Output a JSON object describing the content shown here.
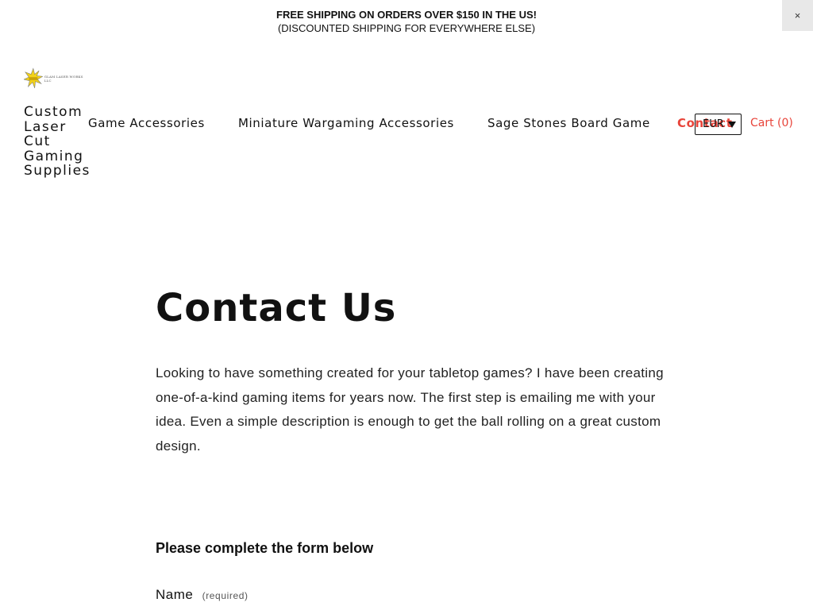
{
  "announcement": {
    "line1": "FREE SHIPPING ON ORDERS OVER $150 IN THE US!",
    "line2": "(DISCOUNTED SHIPPING FOR EVERYWHERE ELSE)",
    "close_label": "×"
  },
  "logo": {
    "text": "GLAM LASER WORKS LLC",
    "icon": "starburst-logo-icon",
    "accent": "#f2d21a"
  },
  "site_title": {
    "lines": [
      "Custom",
      "Laser",
      "Cut",
      "Gaming",
      "Supplies"
    ]
  },
  "nav": {
    "items": [
      {
        "label": "Game Accessories"
      },
      {
        "label": "Miniature Wargaming Accessories"
      },
      {
        "label": "Sage Stones Board Game"
      },
      {
        "label": "Contact"
      }
    ],
    "active_color": "#e8443a"
  },
  "currency": {
    "value": "EUR"
  },
  "cart": {
    "label": "Cart (0)"
  },
  "main": {
    "title": "Contact Us",
    "intro": "Looking to have something created for your tabletop games? I have been creating one-of-a-kind gaming items for years now. The first step is emailing me with your idea. Even a simple description is enough to get the ball rolling on a great custom design.",
    "form_heading": "Please complete the form below",
    "fields": [
      {
        "label": "Name",
        "required_note": "(required)"
      }
    ]
  }
}
